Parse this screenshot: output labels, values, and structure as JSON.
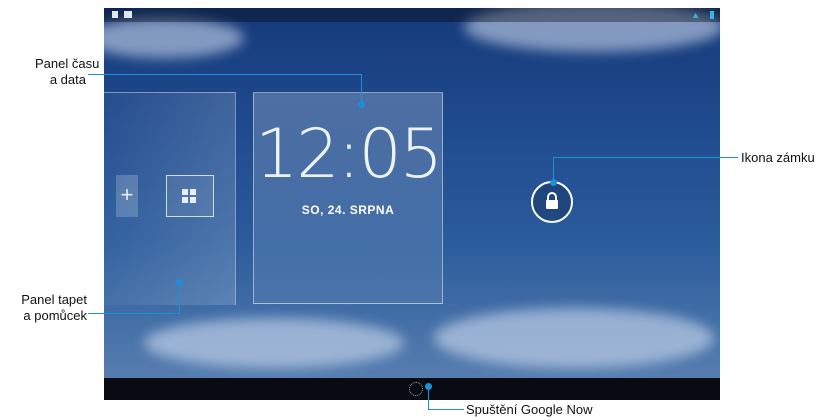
{
  "callouts": {
    "clock_panel": [
      "Panel času",
      "a data"
    ],
    "widget_panel": [
      "Panel tapet",
      "a pomůcek"
    ],
    "lock_icon": "Ikona zámku",
    "google_now": "Spuštění Google Now"
  },
  "lockscreen": {
    "time": "12:05",
    "date": "SO, 24. SRPNA",
    "add_widget_glyph": "+"
  },
  "colors": {
    "callout_line": "#1d8fd8",
    "status_accent": "#35b5e5"
  },
  "icons": {
    "lock": "padlock-icon",
    "add_widget": "plus-icon",
    "widget_grid": "grid-icon",
    "google_now": "dotted-circle-icon",
    "wifi": "wifi-icon",
    "battery": "battery-icon"
  }
}
